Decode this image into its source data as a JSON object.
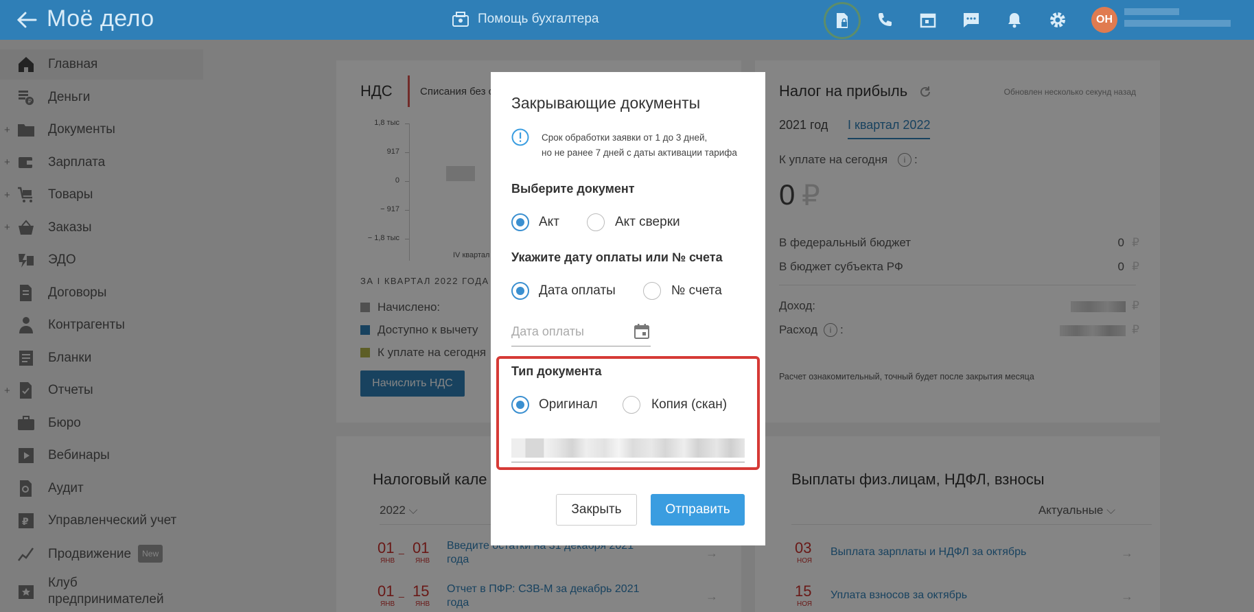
{
  "header": {
    "logo": "Моё дело",
    "help_label": "Помощь бухгалтера",
    "avatar_initials": "ОН"
  },
  "sidebar": {
    "items": [
      {
        "label": "Главная",
        "plus": false,
        "active": true,
        "icon": "home-icon"
      },
      {
        "label": "Деньги",
        "plus": false,
        "icon": "money-icon"
      },
      {
        "label": "Документы",
        "plus": true,
        "icon": "folder-icon"
      },
      {
        "label": "Зарплата",
        "plus": true,
        "icon": "wallet-icon"
      },
      {
        "label": "Товары",
        "plus": true,
        "icon": "cart-icon"
      },
      {
        "label": "Заказы",
        "plus": true,
        "icon": "basket-icon"
      },
      {
        "label": "ЭДО",
        "plus": false,
        "icon": "edo-icon"
      },
      {
        "label": "Договоры",
        "plus": false,
        "icon": "contract-icon"
      },
      {
        "label": "Контрагенты",
        "plus": false,
        "icon": "contractors-icon"
      },
      {
        "label": "Бланки",
        "plus": false,
        "icon": "forms-icon"
      },
      {
        "label": "Отчеты",
        "plus": true,
        "icon": "reports-icon"
      },
      {
        "label": "Бюро",
        "plus": false,
        "icon": "briefcase-icon"
      },
      {
        "label": "Вебинары",
        "plus": false,
        "icon": "webinar-icon"
      },
      {
        "label": "Аудит",
        "plus": false,
        "icon": "audit-icon"
      },
      {
        "label": "Управленческий учет",
        "plus": false,
        "icon": "management-icon"
      },
      {
        "label": "Продвижение",
        "plus": false,
        "icon": "promo-icon",
        "badge": "New"
      },
      {
        "label": "Клуб",
        "label2": "предпринимателей",
        "plus": false,
        "icon": "club-icon"
      }
    ]
  },
  "vat_card": {
    "title": "НДС",
    "tab": "Списания без с",
    "y_ticks": [
      "1,8 тыс",
      "917",
      "0",
      "− 917",
      "− 1,8 тыс"
    ],
    "x_label": "IV квартал",
    "period": "ЗА I КВАРТАЛ 2022 ГОДА",
    "legend": [
      {
        "label": "Начислено:",
        "color": "#9a9a9a"
      },
      {
        "label": "Доступно к вычету",
        "color": "#2f7fb7"
      },
      {
        "label": "К уплате на сегодня",
        "color": "#b3b54a"
      }
    ],
    "button": "Начислить НДС"
  },
  "profit_card": {
    "title": "Налог на прибыль",
    "updated": "Обновлен несколько секунд назад",
    "tabs": [
      "2021 год",
      "I квартал 2022"
    ],
    "due_label": "К уплате на сегодня",
    "due_value": "0",
    "currency": "₽",
    "rows": [
      {
        "label": "В федеральный бюджет",
        "value": "0"
      },
      {
        "label": "В бюджет субъекта РФ",
        "value": "0"
      }
    ],
    "income_label": "Доход:",
    "expense_label": "Расход",
    "note": "Расчет ознакомительный, точный будет после закрытия месяца"
  },
  "calendar_card": {
    "title": "Налоговый кале",
    "year": "2022",
    "events": [
      {
        "d1": "01",
        "m1": "ЯНВ",
        "d2": "01",
        "m2": "ЯНВ",
        "text": "Введите остатки на 31 декабря 2021",
        "text2": "года"
      },
      {
        "d1": "01",
        "m1": "ЯНВ",
        "d2": "15",
        "m2": "ЯНВ",
        "text": "Отчет в ПФР: СЗВ-М за декабрь 2021",
        "text2": "года"
      }
    ]
  },
  "payments_card": {
    "title": "Выплаты физ.лицам, НДФЛ, взносы",
    "filter": "Актуальные",
    "events": [
      {
        "d": "03",
        "m": "НОЯ",
        "text": "Выплата зарплаты и НДФЛ за октябрь"
      },
      {
        "d": "15",
        "m": "НОЯ",
        "text": "Уплата взносов за октябрь"
      }
    ]
  },
  "modal": {
    "title": "Закрывающие документы",
    "info_line1": "Срок обработки заявки от 1 до 3 дней,",
    "info_line2": "но не ранее 7 дней с даты активации тарифа",
    "section_doc": "Выберите документ",
    "doc_opt1": "Акт",
    "doc_opt2": "Акт сверки",
    "section_pay": "Укажите дату оплаты или № счета",
    "pay_opt1": "Дата оплаты",
    "pay_opt2": "№ счета",
    "date_placeholder": "Дата оплаты",
    "section_type": "Тип документа",
    "type_opt1": "Оригинал",
    "type_opt2": "Копия (скан)",
    "btn_close": "Закрыть",
    "btn_send": "Отправить"
  }
}
